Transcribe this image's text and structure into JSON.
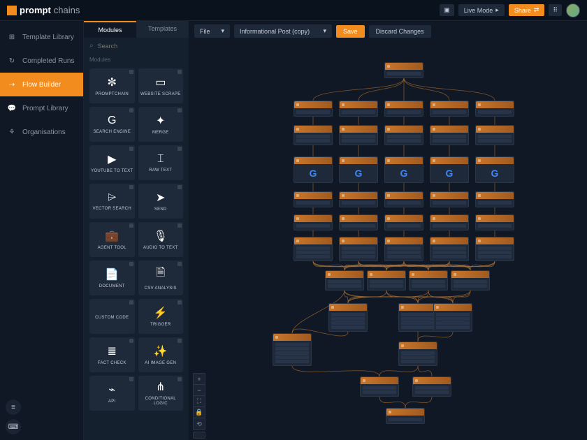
{
  "brand": {
    "part1": "prompt",
    "part2": "chains"
  },
  "header": {
    "live_mode": "Live Mode",
    "share": "Share"
  },
  "sidebar": {
    "items": [
      {
        "label": "Template Library",
        "icon": "⊞"
      },
      {
        "label": "Completed Runs",
        "icon": "↻"
      },
      {
        "label": "Flow Builder",
        "icon": "⇢"
      },
      {
        "label": "Prompt Library",
        "icon": "💬"
      },
      {
        "label": "Organisations",
        "icon": "⚘"
      }
    ]
  },
  "panel": {
    "tab_modules": "Modules",
    "tab_templates": "Templates",
    "search_placeholder": "Search",
    "section": "Modules",
    "module_list": [
      {
        "label": "PROMPTCHAIN",
        "icon": "✼"
      },
      {
        "label": "WEBSITE SCRAPE",
        "icon": "▭"
      },
      {
        "label": "SEARCH ENGINE",
        "icon": "G"
      },
      {
        "label": "MERGE",
        "icon": "✦"
      },
      {
        "label": "YOUTUBE TO TEXT",
        "icon": "▶"
      },
      {
        "label": "RAW TEXT",
        "icon": "⌶"
      },
      {
        "label": "VECTOR SEARCH",
        "icon": "⌲"
      },
      {
        "label": "SEND",
        "icon": "➤"
      },
      {
        "label": "AGENT TOOL",
        "icon": "💼"
      },
      {
        "label": "AUDIO TO TEXT",
        "icon": "🎙"
      },
      {
        "label": "DOCUMENT",
        "icon": "📄"
      },
      {
        "label": "CSV ANALYSIS",
        "icon": "🗎"
      },
      {
        "label": "CUSTOM CODE",
        "icon": "</>"
      },
      {
        "label": "TRIGGER",
        "icon": "⚡"
      },
      {
        "label": "FACT CHECK",
        "icon": "≣"
      },
      {
        "label": "AI IMAGE GEN",
        "icon": "✨"
      },
      {
        "label": "API",
        "icon": "⌁"
      },
      {
        "label": "CONDITIONAL LOGIC",
        "icon": "⋔"
      }
    ]
  },
  "toolbar": {
    "file_label": "File",
    "flow_name": "Informational Post (copy)",
    "save": "Save",
    "discard": "Discard Changes"
  },
  "zoom": {
    "in": "+",
    "out": "−",
    "fit": "⛶",
    "lock": "🔒",
    "reset": "⟲"
  },
  "colors": {
    "accent": "#f28c1f",
    "bg": "#0f1824",
    "panel": "#14202e"
  }
}
